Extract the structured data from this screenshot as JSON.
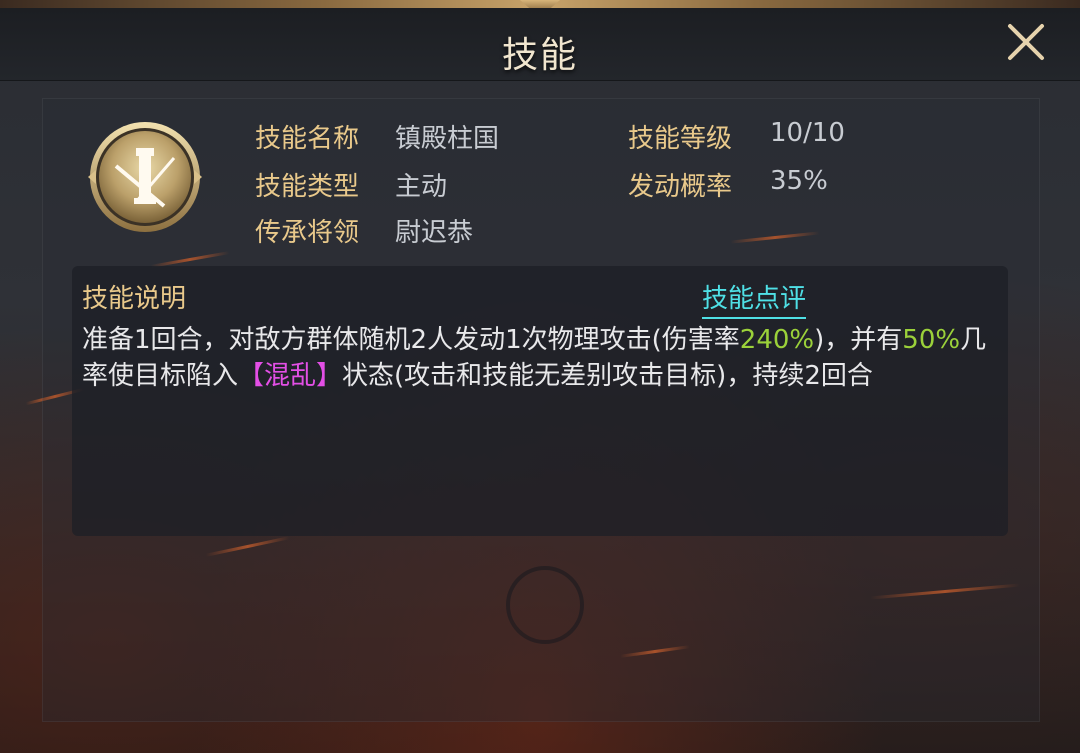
{
  "header": {
    "title": "技能",
    "close_icon": "close-icon"
  },
  "skill": {
    "icon": "skill-emblem-icon",
    "name_label": "技能名称",
    "name_value": "镇殿柱国",
    "level_label": "技能等级",
    "level_value": "10/10",
    "type_label": "技能类型",
    "type_value": "主动",
    "chance_label": "发动概率",
    "chance_value": "35%",
    "inherit_label": "传承将领",
    "inherit_value": "尉迟恭"
  },
  "description": {
    "title": "技能说明",
    "review_link": "技能点评",
    "seg1": "准备1回合，对敌方群体随机2人发动1次物理攻击(伤害率",
    "seg2_highlight": "240%",
    "seg3": ")，并有",
    "seg4_highlight": "50%",
    "seg5": "几率使目标陷入",
    "seg6_status": "【混乱】",
    "seg7": "状态(攻击和技能无差别攻击目标)，持续2回合"
  },
  "colors": {
    "label_gold": "#e9c98b",
    "value_gray": "#c8ccd2",
    "highlight_green": "#9bd13a",
    "status_magenta": "#e34fe6",
    "link_cyan": "#4fe0e6"
  }
}
